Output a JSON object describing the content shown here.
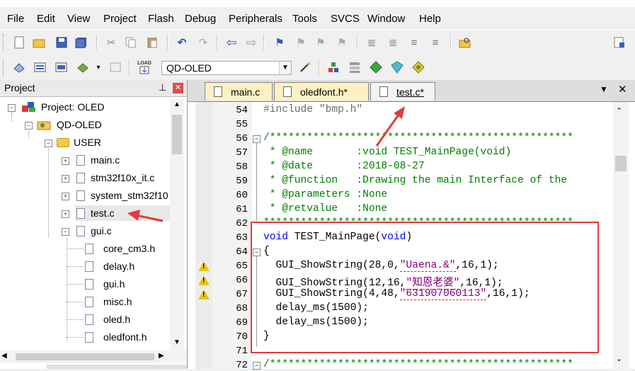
{
  "menu": [
    "File",
    "Edit",
    "View",
    "Project",
    "Flash",
    "Debug",
    "Peripherals",
    "Tools",
    "SVCS",
    "Window",
    "Help"
  ],
  "toolbar": {
    "target": "QD-OLED",
    "load_label": "LOAD"
  },
  "project_panel": {
    "title": "Project",
    "pin": "Ԅ",
    "close": "x",
    "tree": {
      "root": "Project: OLED",
      "target": "QD-OLED",
      "group": "USER",
      "files": [
        "main.c",
        "stm32f10x_it.c",
        "system_stm32f10",
        "test.c",
        "gui.c"
      ],
      "gui_children": [
        "core_cm3.h",
        "delay.h",
        "gui.h",
        "misc.h",
        "oled.h",
        "oledfont.h"
      ]
    }
  },
  "tabs": [
    {
      "label": "main.c"
    },
    {
      "label": "oledfont.h*"
    },
    {
      "label": "test.c*"
    }
  ],
  "tab_controls": {
    "dropdown": "▼",
    "close": "✕"
  },
  "editor": {
    "line_numbers": [
      "54",
      "55",
      "56",
      "57",
      "58",
      "59",
      "60",
      "61",
      "62",
      "63",
      "64",
      "65",
      "66",
      "67",
      "68",
      "69",
      "70",
      "71",
      "72"
    ],
    "lines": {
      "l54": "#include \"bmp.h\"",
      "l56": "/*************************************************",
      "l57": " * @name       :void TEST_MainPage(void)",
      "l58": " * @date       :2018-08-27",
      "l59": " * @function   :Drawing the main Interface of the",
      "l60": " * @parameters :None",
      "l61": " * @retvalue   :None",
      "l62": "**************************************************",
      "l63a": "void",
      "l63b": " TEST_MainPage(",
      "l63c": "void",
      "l63d": ")",
      "l64": "{",
      "l65a": "  GUI_ShowString(28,0,",
      "l65b": "\"Uaena.&\"",
      "l65c": ",16,1);",
      "l66a": "  GUI_ShowString(12,16,",
      "l66b": "\"知恩老婆\"",
      "l66c": ",16,1);",
      "l67a": "  GUI_ShowString(4,48,",
      "l67b": "\"631907060113\"",
      "l67c": ",16,1);",
      "l68": "  delay_ms(1500);",
      "l69": "  delay_ms(1500);",
      "l70": "}",
      "l72": "/*************************************************"
    }
  },
  "colors": {
    "keyword": "#0000ff",
    "comment": "#008000",
    "string": "#800080",
    "highlight_box": "#e23b3b",
    "arrow": "#e23b3b"
  }
}
